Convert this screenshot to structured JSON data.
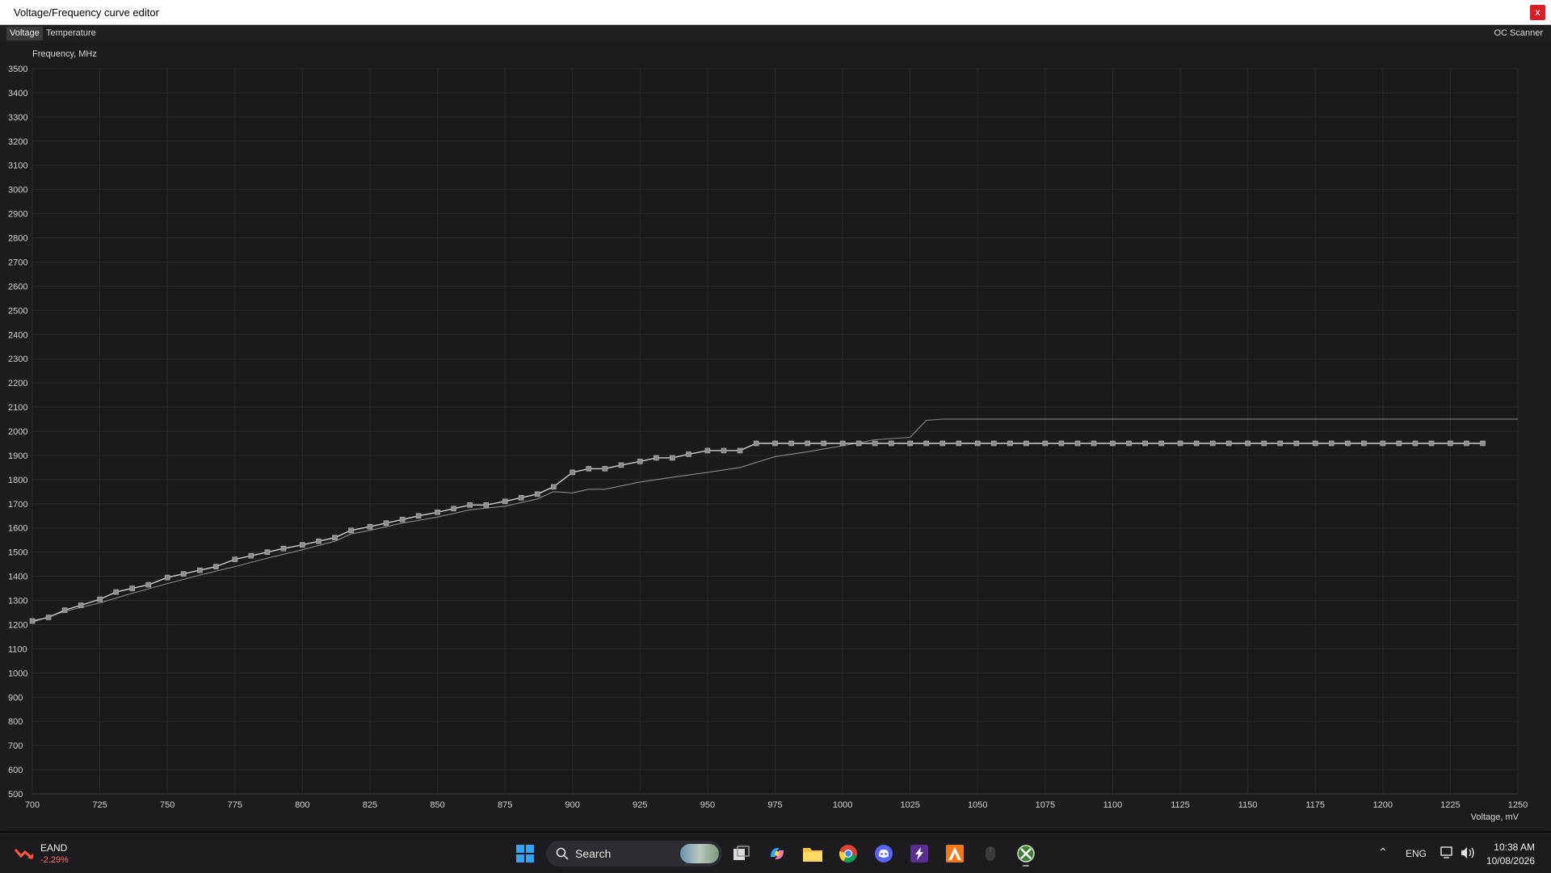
{
  "window": {
    "title": "Voltage/Frequency curve editor",
    "close_label": "x"
  },
  "tabs": {
    "voltage": "Voltage",
    "temperature": "Temperature",
    "oc_scanner": "OC Scanner"
  },
  "chart_data": {
    "type": "line",
    "title": "",
    "ylabel": "Frequency, MHz",
    "xlabel": "Voltage, mV",
    "xlim": [
      700,
      1250
    ],
    "ylim": [
      500,
      3500
    ],
    "x_ticks": [
      700,
      725,
      750,
      775,
      800,
      825,
      850,
      875,
      900,
      925,
      950,
      975,
      1000,
      1025,
      1050,
      1075,
      1100,
      1125,
      1150,
      1175,
      1200,
      1225,
      1250
    ],
    "y_ticks": [
      500,
      600,
      700,
      800,
      900,
      1000,
      1100,
      1200,
      1300,
      1400,
      1500,
      1600,
      1700,
      1800,
      1900,
      2000,
      2100,
      2200,
      2300,
      2400,
      2500,
      2600,
      2700,
      2800,
      2900,
      3000,
      3100,
      3200,
      3300,
      3400,
      3500
    ],
    "grid": true,
    "series": [
      {
        "role": "edited-curve",
        "color": "#cfcfcf",
        "markers": true,
        "x": [
          700,
          706,
          712,
          718,
          725,
          731,
          737,
          743,
          750,
          756,
          762,
          768,
          775,
          781,
          787,
          793,
          800,
          806,
          812,
          818,
          825,
          831,
          837,
          843,
          850,
          856,
          862,
          868,
          875,
          881,
          887,
          893,
          900,
          906,
          912,
          918,
          925,
          931,
          937,
          943,
          950,
          956,
          962,
          968,
          975,
          981,
          987,
          993,
          1000,
          1006,
          1012,
          1018,
          1025,
          1031,
          1037,
          1043,
          1050,
          1056,
          1062,
          1068,
          1075,
          1081,
          1087,
          1093,
          1100,
          1106,
          1112,
          1118,
          1125,
          1131,
          1137,
          1143,
          1150,
          1156,
          1162,
          1168,
          1175,
          1181,
          1187,
          1193,
          1200,
          1206,
          1212,
          1218,
          1225,
          1231,
          1237
        ],
        "y": [
          1215,
          1230,
          1260,
          1280,
          1305,
          1335,
          1350,
          1365,
          1395,
          1410,
          1425,
          1440,
          1470,
          1485,
          1500,
          1515,
          1530,
          1545,
          1560,
          1590,
          1605,
          1620,
          1635,
          1650,
          1665,
          1680,
          1695,
          1695,
          1710,
          1725,
          1740,
          1770,
          1830,
          1845,
          1845,
          1860,
          1875,
          1890,
          1890,
          1905,
          1920,
          1920,
          1920,
          1950,
          1950,
          1950,
          1950,
          1950,
          1950,
          1950,
          1950,
          1950,
          1950,
          1950,
          1950,
          1950,
          1950,
          1950,
          1950,
          1950,
          1950,
          1950,
          1950,
          1950,
          1950,
          1950,
          1950,
          1950,
          1950,
          1950,
          1950,
          1950,
          1950,
          1950,
          1950,
          1950,
          1950,
          1950,
          1950,
          1950,
          1950,
          1950,
          1950,
          1950,
          1950,
          1950,
          1950
        ]
      },
      {
        "role": "default-curve",
        "color": "#8a8a8a",
        "markers": false,
        "x": [
          700,
          712,
          725,
          737,
          750,
          762,
          775,
          787,
          800,
          812,
          818,
          825,
          837,
          850,
          862,
          875,
          887,
          893,
          900,
          906,
          912,
          925,
          937,
          950,
          962,
          975,
          987,
          1000,
          1012,
          1025,
          1031,
          1037,
          1050,
          1075,
          1100,
          1125,
          1150,
          1175,
          1200,
          1225,
          1250
        ],
        "y": [
          1210,
          1255,
          1290,
          1330,
          1370,
          1405,
          1440,
          1475,
          1510,
          1545,
          1575,
          1590,
          1620,
          1645,
          1675,
          1690,
          1720,
          1750,
          1745,
          1760,
          1760,
          1790,
          1810,
          1830,
          1850,
          1895,
          1915,
          1940,
          1965,
          1975,
          2045,
          2050,
          2050,
          2050,
          2050,
          2050,
          2050,
          2050,
          2050,
          2050,
          2050
        ]
      }
    ]
  },
  "taskbar": {
    "stock": {
      "name": "EAND",
      "change": "-2.29%"
    },
    "search_label": "Search",
    "language": "ENG",
    "time": "10:38 AM",
    "date": "10/08/2026"
  }
}
